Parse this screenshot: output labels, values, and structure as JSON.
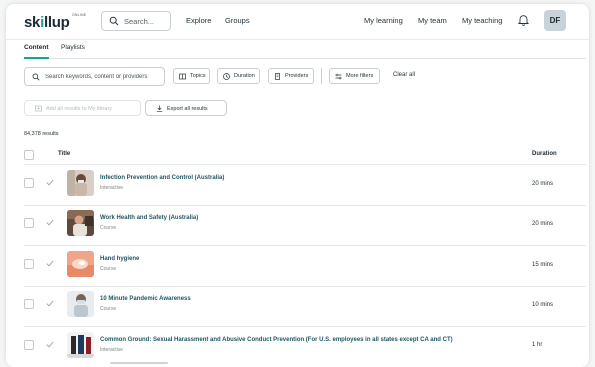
{
  "brand": {
    "logo_pre": "sk",
    "logo_i": "i",
    "logo_post": "llup",
    "logo_sup": "ONLINE"
  },
  "header": {
    "search_placeholder": "Search...",
    "nav_left": [
      "Explore",
      "Groups"
    ],
    "nav_right": [
      "My learning",
      "My team",
      "My teaching"
    ],
    "avatar_initials": "DF"
  },
  "tabs": [
    "Content",
    "Playlists"
  ],
  "filters": {
    "keyword_placeholder": "Search keywords, content or providers",
    "chips": [
      "Topics",
      "Duration",
      "Providers",
      "More filters"
    ],
    "clear_label": "Clear all"
  },
  "actions": {
    "add_all": "Add all results to My library",
    "export_all": "Export all results"
  },
  "results_count": "84,378 results",
  "table": {
    "columns": {
      "title": "Title",
      "duration": "Duration"
    },
    "rows": [
      {
        "title": "Infection Prevention and Control (Australia)",
        "type": "Interactive",
        "duration": "20 mins"
      },
      {
        "title": "Work Health and Safety (Australia)",
        "type": "Course",
        "duration": "20 mins"
      },
      {
        "title": "Hand hygiene",
        "type": "Course",
        "duration": "15 mins"
      },
      {
        "title": "10 Minute Pandemic Awareness",
        "type": "Course",
        "duration": "10 mins"
      },
      {
        "title": "Common Ground: Sexual Harassment and Abusive Conduct Prevention (For U.S. employees in all states except CA and CT)",
        "type": "Interactive",
        "duration": "1 hr"
      }
    ]
  },
  "colors": {
    "accent": "#17a38f",
    "link": "#1f5761"
  }
}
